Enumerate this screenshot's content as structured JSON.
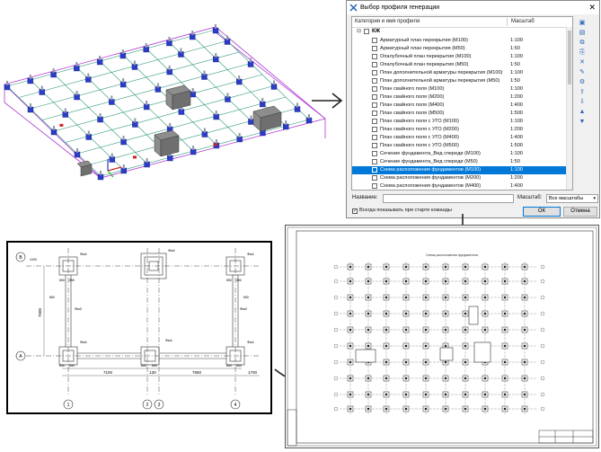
{
  "dialog": {
    "title": "Выбор профиля генерации",
    "close_glyph": "✕",
    "column_name": "Категория и имя профиля",
    "column_scale": "Масштаб",
    "group": {
      "name": "КЖ",
      "expander": "⊟"
    },
    "items": [
      {
        "name": "Арматурный план перекрытия (М100)",
        "scale": "1:100",
        "selected": false
      },
      {
        "name": "Арматурный план перекрытия (М50)",
        "scale": "1:50",
        "selected": false
      },
      {
        "name": "Опалубочный план перекрытия (М100)",
        "scale": "1:100",
        "selected": false
      },
      {
        "name": "Опалубочный план перекрытия (М50)",
        "scale": "1:50",
        "selected": false
      },
      {
        "name": "План дополнительной арматуры перекрытия (М100)",
        "scale": "1:100",
        "selected": false
      },
      {
        "name": "План дополнительной арматуры перекрытия (М50)",
        "scale": "1:50",
        "selected": false
      },
      {
        "name": "План свайного поля (М100)",
        "scale": "1:100",
        "selected": false
      },
      {
        "name": "План свайного поля (М200)",
        "scale": "1:200",
        "selected": false
      },
      {
        "name": "План свайного поля (М400)",
        "scale": "1:400",
        "selected": false
      },
      {
        "name": "План свайного поля (М500)",
        "scale": "1:500",
        "selected": false
      },
      {
        "name": "План свайного поля с УГО (М100)",
        "scale": "1:100",
        "selected": false
      },
      {
        "name": "План свайного поля с УГО (М200)",
        "scale": "1:200",
        "selected": false
      },
      {
        "name": "План свайного поля с УГО (М400)",
        "scale": "1:400",
        "selected": false
      },
      {
        "name": "План свайного поля с УГО (М500)",
        "scale": "1:500",
        "selected": false
      },
      {
        "name": "Сечение фундамента_Вид спереди (М100)",
        "scale": "1:100",
        "selected": false
      },
      {
        "name": "Сечение фундамента_Вид спереди (М50)",
        "scale": "1:50",
        "selected": false
      },
      {
        "name": "Схема расположения фундаментов (М100)",
        "scale": "1:100",
        "selected": true
      },
      {
        "name": "Схема расположения фундаментов (М200)",
        "scale": "1:200",
        "selected": false
      },
      {
        "name": "Схема расположения фундаментов (М400)",
        "scale": "1:400",
        "selected": false
      }
    ],
    "toolbar_icons": [
      "new-folder-icon",
      "new-profile-icon",
      "copy-icon",
      "paste-icon",
      "delete-icon",
      "rename-icon",
      "properties-icon",
      "export-icon",
      "import-icon",
      "move-up-icon",
      "move-down-icon"
    ],
    "name_label": "Название:",
    "name_value": "",
    "scale_label": "Масштаб:",
    "scale_value": "Все масштабы",
    "show_on_start_label": "Всегда показывать при старте команды",
    "show_on_start_checked": true,
    "ok_label": "ОК",
    "cancel_label": "Отмена"
  },
  "plan": {
    "axes_letters": [
      "В",
      "А"
    ],
    "axes_numbers": [
      "1",
      "2",
      "3",
      "4"
    ],
    "dims_bottom": [
      "7100",
      "130",
      "7550",
      "1700"
    ],
    "dim_vertical": "7500",
    "pile_labels": [
      "Фм1",
      "Фм1",
      "Фм1",
      "Фм1",
      "Фм1",
      "Фм1",
      "Фм2",
      "Фм2"
    ],
    "small_dims": [
      "1000",
      "850",
      "850",
      "850",
      "850",
      "850",
      "850",
      "850",
      "850",
      "850",
      "850",
      "850",
      "850"
    ]
  },
  "sheet": {
    "drawing_title": "Схема расположения фундаментов"
  },
  "colors": {
    "selection": "#0078d7",
    "model_grid": "#2e9a7a",
    "model_blue": "#2b3cc8",
    "model_frame": "#b03bd6",
    "model_red": "#d62020"
  }
}
